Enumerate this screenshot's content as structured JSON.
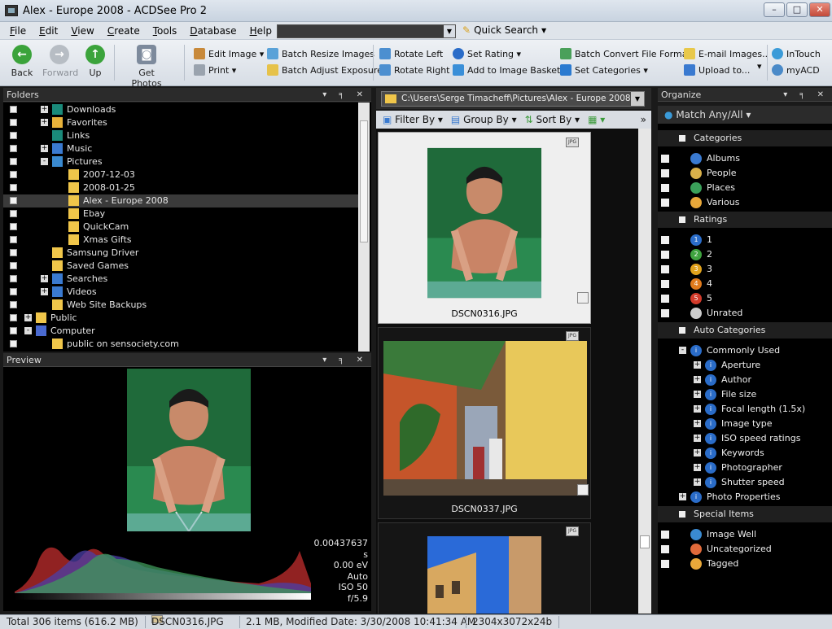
{
  "window": {
    "title": "Alex - Europe 2008 - ACDSee Pro 2"
  },
  "menu": [
    "File",
    "Edit",
    "View",
    "Create",
    "Tools",
    "Database",
    "Help"
  ],
  "quick_search": "Quick Search",
  "toolbar": {
    "back": "Back",
    "forward": "Forward",
    "up": "Up",
    "get_photos": "Get Photos",
    "edit_image": "Edit Image",
    "print": "Print",
    "batch_resize": "Batch Resize Images",
    "batch_adjust": "Batch Adjust Exposure",
    "rotate_left": "Rotate Left",
    "rotate_right": "Rotate Right",
    "set_rating": "Set Rating",
    "add_basket": "Add to Image Basket",
    "batch_convert": "Batch Convert File Format",
    "set_categories": "Set Categories",
    "email": "E-mail Images..",
    "upload": "Upload to...",
    "intouch": "InTouch",
    "myacd": "myACD"
  },
  "folders": {
    "title": "Folders",
    "items": [
      {
        "label": "Downloads",
        "expand": "+"
      },
      {
        "label": "Favorites",
        "expand": "+"
      },
      {
        "label": "Links",
        "expand": ""
      },
      {
        "label": "Music",
        "expand": "+"
      },
      {
        "label": "Pictures",
        "expand": "-"
      },
      {
        "label": "2007-12-03",
        "expand": ""
      },
      {
        "label": "2008-01-25",
        "expand": ""
      },
      {
        "label": "Alex - Europe 2008",
        "expand": ""
      },
      {
        "label": "Ebay",
        "expand": ""
      },
      {
        "label": "QuickCam",
        "expand": ""
      },
      {
        "label": "Xmas Gifts",
        "expand": ""
      },
      {
        "label": "Samsung Driver",
        "expand": ""
      },
      {
        "label": "Saved Games",
        "expand": ""
      },
      {
        "label": "Searches",
        "expand": "+"
      },
      {
        "label": "Videos",
        "expand": "+"
      },
      {
        "label": "Web Site Backups",
        "expand": ""
      },
      {
        "label": "Public",
        "expand": "+"
      },
      {
        "label": "Computer",
        "expand": "-"
      },
      {
        "label": "public on sensociety.com",
        "expand": ""
      }
    ]
  },
  "preview": {
    "title": "Preview",
    "exif": [
      "0.00437637 s",
      "0.00 eV",
      "Auto",
      "ISO 50",
      "f/5.9"
    ]
  },
  "filelist": {
    "path": "C:\\Users\\Serge Timacheff\\Pictures\\Alex - Europe 2008",
    "filter_by": "Filter By",
    "group_by": "Group By",
    "sort_by": "Sort By",
    "files": [
      "DSCN0316.JPG",
      "DSCN0337.JPG"
    ]
  },
  "organize": {
    "title": "Organize",
    "match": "Match Any/All",
    "categories_header": "Categories",
    "categories": [
      "Albums",
      "People",
      "Places",
      "Various"
    ],
    "ratings_header": "Ratings",
    "ratings": [
      "1",
      "2",
      "3",
      "4",
      "5",
      "Unrated"
    ],
    "auto_header": "Auto Categories",
    "commonly_used": "Commonly Used",
    "auto_items": [
      "Aperture",
      "Author",
      "File size",
      "Focal length (1.5x)",
      "Image type",
      "ISO speed ratings",
      "Keywords",
      "Photographer",
      "Shutter speed"
    ],
    "photo_props": "Photo Properties",
    "special_header": "Special Items",
    "special": [
      "Image Well",
      "Uncategorized",
      "Tagged"
    ]
  },
  "status": {
    "total": "Total 306 items  (616.2 MB)",
    "file": "DSCN0316.JPG",
    "info": "2.1 MB, Modified Date: 3/30/2008 10:41:34 AM",
    "dims": "2304x3072x24b"
  },
  "colors": {
    "accent": "#f0c64a",
    "rating1": "#2a6cc8",
    "rating2": "#3fa33f",
    "rating3": "#e0a21c",
    "rating4": "#e07a1c",
    "rating5": "#d23a2a"
  }
}
